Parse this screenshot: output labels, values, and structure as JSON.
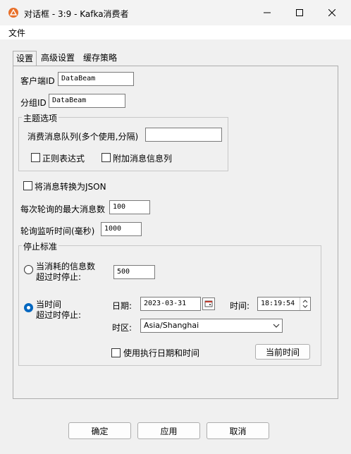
{
  "window": {
    "title": "对话框 - 3:9 - Kafka消费者"
  },
  "menu": {
    "file": "文件"
  },
  "tabs": [
    {
      "label": "设置"
    },
    {
      "label": "高级设置"
    },
    {
      "label": "缓存策略"
    }
  ],
  "settings": {
    "client_id_label": "客户端ID",
    "client_id_value": "DataBeam",
    "group_id_label": "分组ID",
    "group_id_value": "DataBeam",
    "topic_group": {
      "legend": "主题选项",
      "queue_label": "消费消息队列(多个使用,分隔)",
      "queue_value": "",
      "regex_label": "正则表达式",
      "regex_checked": false,
      "append_info_label": "附加消息信息列",
      "append_info_checked": false
    },
    "to_json_label": "将消息转换为JSON",
    "to_json_checked": false,
    "max_messages_label": "每次轮询的最大消息数",
    "max_messages_value": "100",
    "poll_timeout_label": "轮询监听时间(毫秒)",
    "poll_timeout_value": "1000",
    "stop": {
      "legend": "停止标准",
      "count_option_line1": "当消耗的信息数",
      "count_option_line2": "超过时停止:",
      "count_value": "500",
      "time_option_line1": "当时间",
      "time_option_line2": "超过时停止:",
      "selected_option": "time",
      "date_label": "日期:",
      "date_value": "2023-03-31",
      "time_label": "时间:",
      "time_value": "18:19:54",
      "timezone_label": "时区:",
      "timezone_value": "Asia/Shanghai",
      "use_exec_label": "使用执行日期和时间",
      "use_exec_checked": false,
      "current_time_button": "当前时间"
    }
  },
  "buttons": {
    "ok": "确定",
    "apply": "应用",
    "cancel": "取消"
  }
}
